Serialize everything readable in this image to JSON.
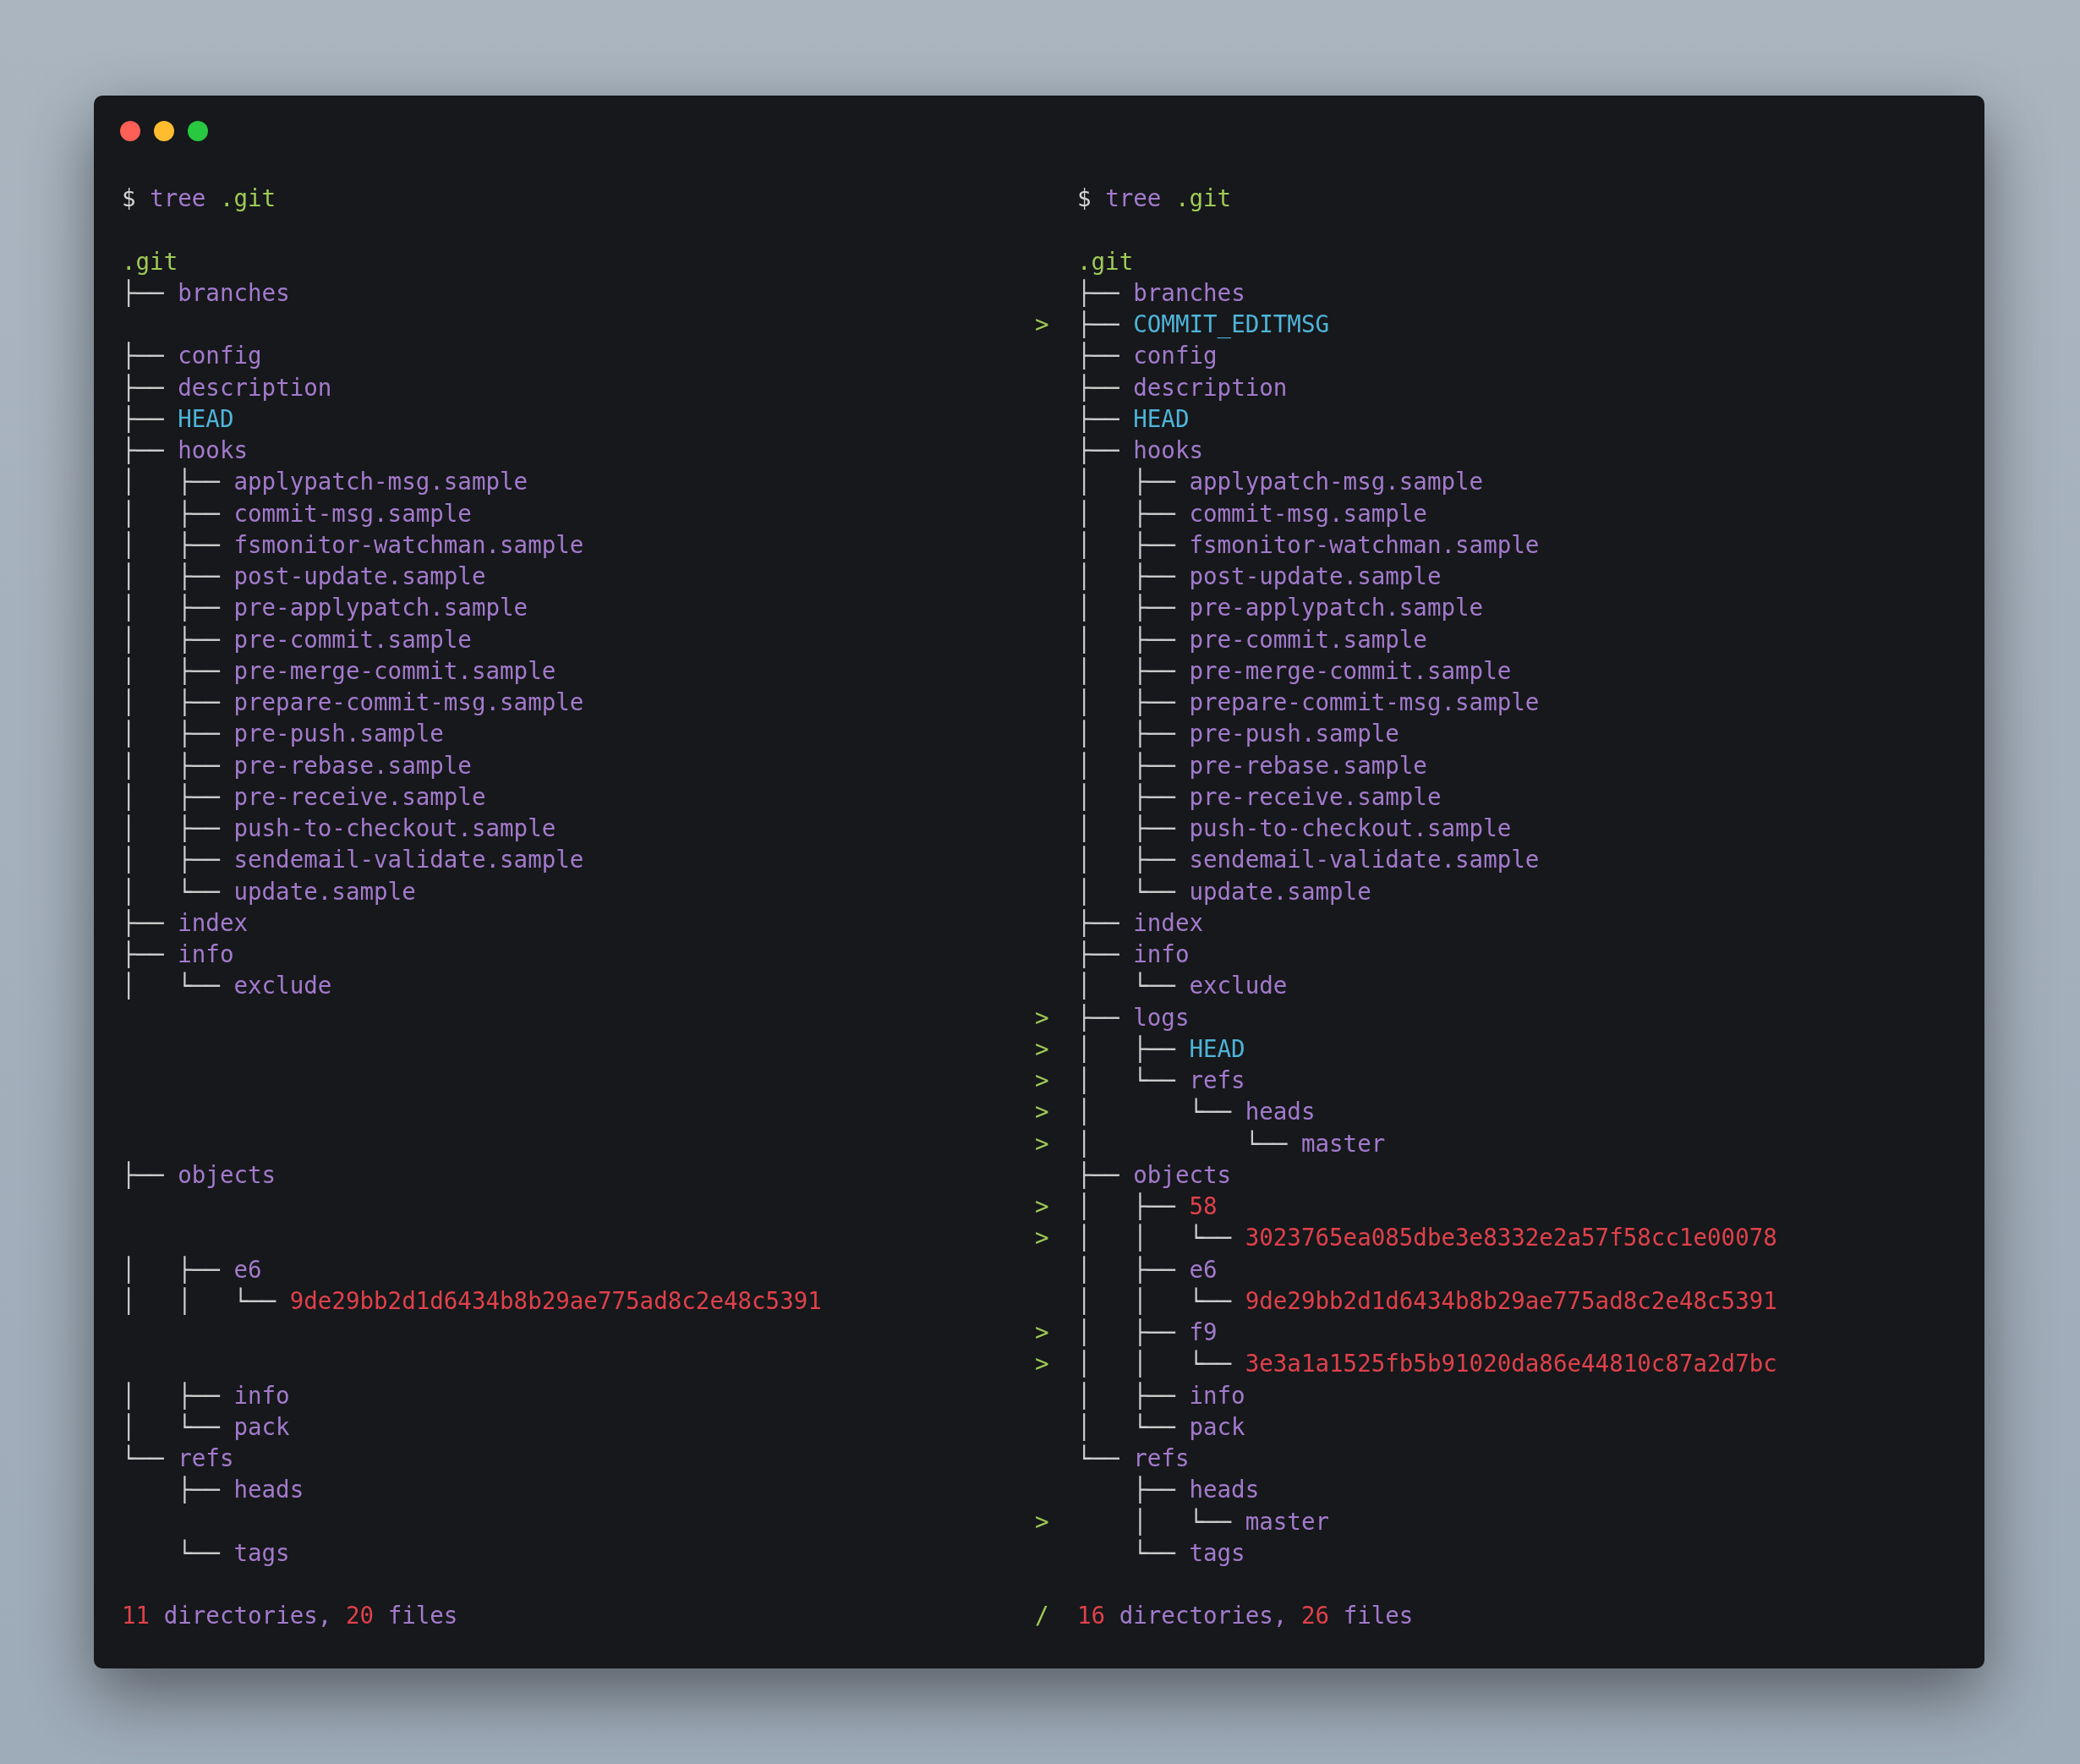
{
  "window": {
    "controls": [
      {
        "color": "#fe5f57"
      },
      {
        "color": "#febc2e"
      },
      {
        "color": "#28c840"
      }
    ]
  },
  "prompt": {
    "left": {
      "symbol": "$",
      "command": "tree",
      "arg": ".git"
    },
    "right": {
      "symbol": "$",
      "command": "tree",
      "arg": ".git"
    }
  },
  "rows": [
    {
      "left": {
        "name": ".git",
        "color": "#9fca56"
      },
      "right": {
        "name": ".git",
        "color": "#9fca56"
      }
    },
    {
      "left": {
        "prefix": "├── ",
        "name": "branches",
        "color": "#a37acc"
      },
      "right": {
        "prefix": "├── ",
        "name": "branches",
        "color": "#a37acc"
      }
    },
    {
      "marker": ">",
      "right": {
        "prefix": "├── ",
        "name": "COMMIT_EDITMSG",
        "color": "#4fb4d8"
      }
    },
    {
      "left": {
        "prefix": "├── ",
        "name": "config",
        "color": "#a37acc"
      },
      "right": {
        "prefix": "├── ",
        "name": "config",
        "color": "#a37acc"
      }
    },
    {
      "left": {
        "prefix": "├── ",
        "name": "description",
        "color": "#a37acc"
      },
      "right": {
        "prefix": "├── ",
        "name": "description",
        "color": "#a37acc"
      }
    },
    {
      "left": {
        "prefix": "├── ",
        "name": "HEAD",
        "color": "#4fb4d8"
      },
      "right": {
        "prefix": "├── ",
        "name": "HEAD",
        "color": "#4fb4d8"
      }
    },
    {
      "left": {
        "prefix": "├── ",
        "name": "hooks",
        "color": "#a37acc"
      },
      "right": {
        "prefix": "├── ",
        "name": "hooks",
        "color": "#a37acc"
      }
    },
    {
      "left": {
        "prefix": "│   ├── ",
        "name": "applypatch-msg.sample",
        "color": "#a37acc"
      },
      "right": {
        "prefix": "│   ├── ",
        "name": "applypatch-msg.sample",
        "color": "#a37acc"
      }
    },
    {
      "left": {
        "prefix": "│   ├── ",
        "name": "commit-msg.sample",
        "color": "#a37acc"
      },
      "right": {
        "prefix": "│   ├── ",
        "name": "commit-msg.sample",
        "color": "#a37acc"
      }
    },
    {
      "left": {
        "prefix": "│   ├── ",
        "name": "fsmonitor-watchman.sample",
        "color": "#a37acc"
      },
      "right": {
        "prefix": "│   ├── ",
        "name": "fsmonitor-watchman.sample",
        "color": "#a37acc"
      }
    },
    {
      "left": {
        "prefix": "│   ├── ",
        "name": "post-update.sample",
        "color": "#a37acc"
      },
      "right": {
        "prefix": "│   ├── ",
        "name": "post-update.sample",
        "color": "#a37acc"
      }
    },
    {
      "left": {
        "prefix": "│   ├── ",
        "name": "pre-applypatch.sample",
        "color": "#a37acc"
      },
      "right": {
        "prefix": "│   ├── ",
        "name": "pre-applypatch.sample",
        "color": "#a37acc"
      }
    },
    {
      "left": {
        "prefix": "│   ├── ",
        "name": "pre-commit.sample",
        "color": "#a37acc"
      },
      "right": {
        "prefix": "│   ├── ",
        "name": "pre-commit.sample",
        "color": "#a37acc"
      }
    },
    {
      "left": {
        "prefix": "│   ├── ",
        "name": "pre-merge-commit.sample",
        "color": "#a37acc"
      },
      "right": {
        "prefix": "│   ├── ",
        "name": "pre-merge-commit.sample",
        "color": "#a37acc"
      }
    },
    {
      "left": {
        "prefix": "│   ├── ",
        "name": "prepare-commit-msg.sample",
        "color": "#a37acc"
      },
      "right": {
        "prefix": "│   ├── ",
        "name": "prepare-commit-msg.sample",
        "color": "#a37acc"
      }
    },
    {
      "left": {
        "prefix": "│   ├── ",
        "name": "pre-push.sample",
        "color": "#a37acc"
      },
      "right": {
        "prefix": "│   ├── ",
        "name": "pre-push.sample",
        "color": "#a37acc"
      }
    },
    {
      "left": {
        "prefix": "│   ├── ",
        "name": "pre-rebase.sample",
        "color": "#a37acc"
      },
      "right": {
        "prefix": "│   ├── ",
        "name": "pre-rebase.sample",
        "color": "#a37acc"
      }
    },
    {
      "left": {
        "prefix": "│   ├── ",
        "name": "pre-receive.sample",
        "color": "#a37acc"
      },
      "right": {
        "prefix": "│   ├── ",
        "name": "pre-receive.sample",
        "color": "#a37acc"
      }
    },
    {
      "left": {
        "prefix": "│   ├── ",
        "name": "push-to-checkout.sample",
        "color": "#a37acc"
      },
      "right": {
        "prefix": "│   ├── ",
        "name": "push-to-checkout.sample",
        "color": "#a37acc"
      }
    },
    {
      "left": {
        "prefix": "│   ├── ",
        "name": "sendemail-validate.sample",
        "color": "#a37acc"
      },
      "right": {
        "prefix": "│   ├── ",
        "name": "sendemail-validate.sample",
        "color": "#a37acc"
      }
    },
    {
      "left": {
        "prefix": "│   └── ",
        "name": "update.sample",
        "color": "#a37acc"
      },
      "right": {
        "prefix": "│   └── ",
        "name": "update.sample",
        "color": "#a37acc"
      }
    },
    {
      "left": {
        "prefix": "├── ",
        "name": "index",
        "color": "#a37acc"
      },
      "right": {
        "prefix": "├── ",
        "name": "index",
        "color": "#a37acc"
      }
    },
    {
      "left": {
        "prefix": "├── ",
        "name": "info",
        "color": "#a37acc"
      },
      "right": {
        "prefix": "├── ",
        "name": "info",
        "color": "#a37acc"
      }
    },
    {
      "left": {
        "prefix": "│   └── ",
        "name": "exclude",
        "color": "#a37acc"
      },
      "right": {
        "prefix": "│   └── ",
        "name": "exclude",
        "color": "#a37acc"
      }
    },
    {
      "marker": ">",
      "right": {
        "prefix": "├── ",
        "name": "logs",
        "color": "#a37acc"
      }
    },
    {
      "marker": ">",
      "right": {
        "prefix": "│   ├── ",
        "name": "HEAD",
        "color": "#4fb4d8"
      }
    },
    {
      "marker": ">",
      "right": {
        "prefix": "│   └── ",
        "name": "refs",
        "color": "#a37acc"
      }
    },
    {
      "marker": ">",
      "right": {
        "prefix": "│       └── ",
        "name": "heads",
        "color": "#a37acc"
      }
    },
    {
      "marker": ">",
      "right": {
        "prefix": "│           └── ",
        "name": "master",
        "color": "#a37acc"
      }
    },
    {
      "left": {
        "prefix": "├── ",
        "name": "objects",
        "color": "#a37acc"
      },
      "right": {
        "prefix": "├── ",
        "name": "objects",
        "color": "#a37acc"
      }
    },
    {
      "marker": ">",
      "right": {
        "prefix": "│   ├── ",
        "name": "58",
        "color": "#e0414b"
      }
    },
    {
      "marker": ">",
      "right": {
        "prefix": "│   │   └── ",
        "name": "3023765ea085dbe3e8332e2a57f58cc1e00078",
        "color": "#e0414b"
      }
    },
    {
      "left": {
        "prefix": "│   ├── ",
        "name": "e6",
        "color": "#a37acc"
      },
      "right": {
        "prefix": "│   ├── ",
        "name": "e6",
        "color": "#a37acc"
      }
    },
    {
      "left": {
        "prefix": "│   │   └── ",
        "name": "9de29bb2d1d6434b8b29ae775ad8c2e48c5391",
        "color": "#e0414b"
      },
      "right": {
        "prefix": "│   │   └── ",
        "name": "9de29bb2d1d6434b8b29ae775ad8c2e48c5391",
        "color": "#e0414b"
      }
    },
    {
      "marker": ">",
      "right": {
        "prefix": "│   ├── ",
        "name": "f9",
        "color": "#a37acc"
      }
    },
    {
      "marker": ">",
      "right": {
        "prefix": "│   │   └── ",
        "name": "3e3a1a1525fb5b91020da86e44810c87a2d7bc",
        "color": "#e0414b"
      }
    },
    {
      "left": {
        "prefix": "│   ├── ",
        "name": "info",
        "color": "#a37acc"
      },
      "right": {
        "prefix": "│   ├── ",
        "name": "info",
        "color": "#a37acc"
      }
    },
    {
      "left": {
        "prefix": "│   └── ",
        "name": "pack",
        "color": "#a37acc"
      },
      "right": {
        "prefix": "│   └── ",
        "name": "pack",
        "color": "#a37acc"
      }
    },
    {
      "left": {
        "prefix": "└── ",
        "name": "refs",
        "color": "#a37acc"
      },
      "right": {
        "prefix": "└── ",
        "name": "refs",
        "color": "#a37acc"
      }
    },
    {
      "left": {
        "prefix": "    ├── ",
        "name": "heads",
        "color": "#a37acc"
      },
      "right": {
        "prefix": "    ├── ",
        "name": "heads",
        "color": "#a37acc"
      }
    },
    {
      "marker": ">",
      "right": {
        "prefix": "    │   └── ",
        "name": "master",
        "color": "#a37acc"
      }
    },
    {
      "left": {
        "prefix": "    └── ",
        "name": "tags",
        "color": "#a37acc"
      },
      "right": {
        "prefix": "    └── ",
        "name": "tags",
        "color": "#a37acc"
      }
    }
  ],
  "summary": {
    "marker": "/",
    "left": {
      "dirs": "11",
      "dirs_label": "directories,",
      "files": "20",
      "files_label": "files"
    },
    "right": {
      "dirs": "16",
      "dirs_label": "directories,",
      "files": "26",
      "files_label": "files"
    }
  }
}
